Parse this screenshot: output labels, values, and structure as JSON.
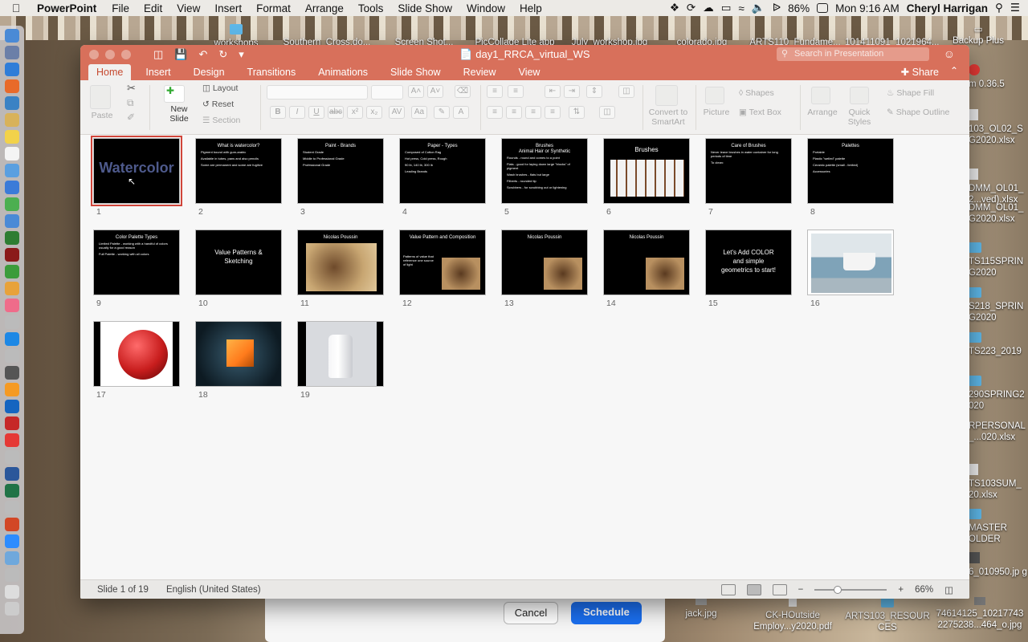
{
  "menubar": {
    "app_name": "PowerPoint",
    "items": [
      "File",
      "Edit",
      "View",
      "Insert",
      "Format",
      "Arrange",
      "Tools",
      "Slide Show",
      "Window",
      "Help"
    ],
    "battery": "86%",
    "clock": "Mon 9:16 AM",
    "user": "Cheryl Harrigan"
  },
  "desktop_files": [
    {
      "label": "workshops"
    },
    {
      "label": "Southern_Cross.do..."
    },
    {
      "label": "Screen Shot..."
    },
    {
      "label": "PicCollage Lite app"
    },
    {
      "label": "July_workshop.jpg"
    },
    {
      "label": "colorado.jpg"
    },
    {
      "label": "ARTS110_Fundame..."
    },
    {
      "label": "101411091_1021964..."
    },
    {
      "label": "Backup Plus"
    },
    {
      "label": "m 0.36.5"
    },
    {
      "label": "103_OL02_S G2020.xlsx"
    },
    {
      "label": "DMM_OL01_ 2...ved).xlsx"
    },
    {
      "label": "DMM_OL01_ G2020.xlsx"
    },
    {
      "label": "TS115SPRIN G2020"
    },
    {
      "label": "S218_SPRIN G2020"
    },
    {
      "label": "TS223_2019"
    },
    {
      "label": "290SPRING2 020"
    },
    {
      "label": "RPERSONAL _...020.xlsx"
    },
    {
      "label": "TS103SUM_ 20.xlsx"
    },
    {
      "label": "MASTER OLDER"
    },
    {
      "label": "6_010950.jp g"
    },
    {
      "label": "jack.jpg"
    },
    {
      "label": "CK-HOutside Employ...y2020.pdf"
    },
    {
      "label": "ARTS103_RESOUR CES"
    },
    {
      "label": "74614125_10217743 2275238...464_o.jpg"
    }
  ],
  "window": {
    "doc_title": "day1_RRCA_virtual_WS",
    "search_placeholder": "Search in Presentation",
    "tabs": [
      "Home",
      "Insert",
      "Design",
      "Transitions",
      "Animations",
      "Slide Show",
      "Review",
      "View"
    ],
    "active_tab": "Home",
    "share_label": "Share"
  },
  "ribbon": {
    "paste": "Paste",
    "new_slide": "New\nSlide",
    "layout": "Layout",
    "reset": "Reset",
    "section": "Section",
    "convert_smartart": "Convert to\nSmartArt",
    "picture": "Picture",
    "text_box": "Text Box",
    "shapes": "Shapes",
    "arrange": "Arrange",
    "quick_styles": "Quick\nStyles",
    "shape_fill": "Shape Fill",
    "shape_outline": "Shape Outline"
  },
  "slides": [
    {
      "num": "1",
      "title": "Watercolor",
      "kind": "title",
      "bullets": []
    },
    {
      "num": "2",
      "title": "What is watercolor?",
      "kind": "bullets",
      "bullets": [
        "Pigment bound with gum-arabic",
        "Available in tubes, pans and also pencils",
        "Some are permanent and some are fugitive"
      ]
    },
    {
      "num": "3",
      "title": "Paint - Brands",
      "kind": "bullets",
      "bullets": [
        "Student Grade",
        "Middle to Professional Grade",
        "Professional Grade"
      ]
    },
    {
      "num": "4",
      "title": "Paper - Types",
      "kind": "bullets",
      "bullets": [
        "Composed of Cotton Rag",
        "Hot press, Cold press, Rough",
        "90 lb, 140 lb, 300 lb",
        "Leading Brands"
      ]
    },
    {
      "num": "5",
      "title": "Brushes\nAnimal Hair or Synthetic",
      "kind": "bullets",
      "bullets": [
        "Rounds - round and comes to a point",
        "Flats - good for laying down large \"blocks\" of pigment",
        "Wash brushes - flats but large",
        "Filberts - rounded tip",
        "Scrubbers - for scrubbing out or lightening"
      ]
    },
    {
      "num": "6",
      "title": "Brushes",
      "kind": "brushes",
      "bullets": []
    },
    {
      "num": "7",
      "title": "Care of Brushes",
      "kind": "bullets",
      "bullets": [
        "Never leave brushes in water container for long periods of time",
        "To clean:"
      ]
    },
    {
      "num": "8",
      "title": "Palettes",
      "kind": "bullets",
      "bullets": [
        "Portable",
        "Plastic \"welled\" palette",
        "Ceramic palette (small - limited)",
        "Accessories"
      ]
    },
    {
      "num": "9",
      "title": "Color Palette Types",
      "kind": "bullets",
      "bullets": [
        "Limited Palette - working with a handful of colors usually for a good reason",
        "Full Palette - working with all colors"
      ]
    },
    {
      "num": "10",
      "title": "Value Patterns &\nSketching",
      "kind": "center",
      "bullets": []
    },
    {
      "num": "11",
      "title": "Nicolas Poussin",
      "kind": "poussin",
      "bullets": []
    },
    {
      "num": "12",
      "title": "Value Pattern and Composition",
      "kind": "poussin-small",
      "bullets": [
        "Patterns of value that reference one source of light"
      ]
    },
    {
      "num": "13",
      "title": "Nicolas Poussin",
      "kind": "poussin-small",
      "bullets": []
    },
    {
      "num": "14",
      "title": "Nicolas Poussin",
      "kind": "poussin-small",
      "bullets": []
    },
    {
      "num": "15",
      "title": "Let's Add COLOR\nand simple\ngeometrics to start!",
      "kind": "center",
      "bullets": []
    },
    {
      "num": "16",
      "title": "",
      "kind": "boat",
      "bullets": []
    },
    {
      "num": "17",
      "title": "",
      "kind": "sphere",
      "bullets": []
    },
    {
      "num": "18",
      "title": "",
      "kind": "cube",
      "bullets": []
    },
    {
      "num": "19",
      "title": "",
      "kind": "cylinder",
      "bullets": []
    }
  ],
  "status": {
    "slide_info": "Slide 1 of 19",
    "language": "English (United States)",
    "zoom": "66%"
  },
  "dialog": {
    "cancel": "Cancel",
    "schedule": "Schedule"
  },
  "colors": {
    "accent": "#d8705b",
    "selection": "#d0453a",
    "schedule_button": "#1b6ff0"
  }
}
